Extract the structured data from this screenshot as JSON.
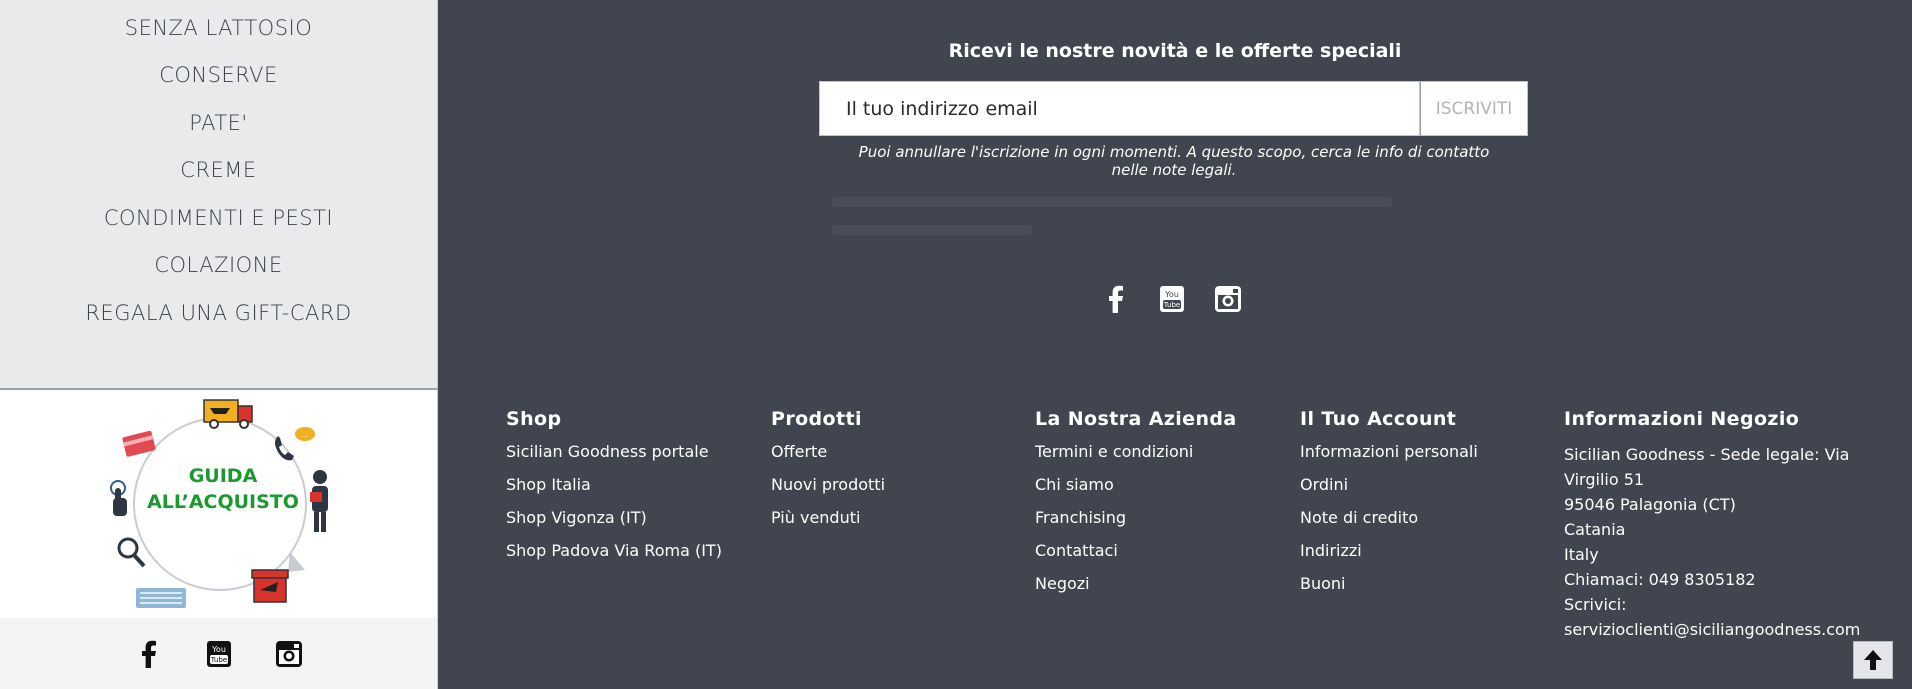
{
  "sidebar": {
    "categories": [
      {
        "label": "SENZA LATTOSIO"
      },
      {
        "label": "CONSERVE"
      },
      {
        "label": "PATE'"
      },
      {
        "label": "CREME"
      },
      {
        "label": "CONDIMENTI E PESTI"
      },
      {
        "label": "COLAZIONE"
      },
      {
        "label": "REGALA UNA GIFT-CARD"
      }
    ],
    "guide_banner": {
      "line1": "GUIDA",
      "line2": "ALL’ACQUISTO"
    },
    "social_icons": [
      "facebook-icon",
      "youtube-icon",
      "instagram-icon"
    ]
  },
  "newsletter": {
    "title": "Ricevi le nostre novità e le offerte speciali",
    "email_placeholder": "Il tuo indirizzo email",
    "subscribe_label": "ISCRIVITI",
    "note": "Puoi annullare l'iscrizione in ogni momenti. A questo scopo, cerca le info di contatto nelle note legali."
  },
  "social_icons": [
    "facebook-icon",
    "youtube-icon",
    "instagram-icon"
  ],
  "footer": {
    "shop": {
      "title": "Shop",
      "links": [
        "Sicilian Goodness portale",
        "Shop Italia",
        "Shop Vigonza (IT)",
        "Shop Padova Via Roma (IT)"
      ]
    },
    "prodotti": {
      "title": "Prodotti",
      "links": [
        "Offerte",
        "Nuovi prodotti",
        "Più venduti"
      ]
    },
    "azienda": {
      "title": "La Nostra Azienda",
      "links": [
        "Termini e condizioni",
        "Chi siamo",
        "Franchising",
        "Contattaci",
        "Negozi"
      ]
    },
    "account": {
      "title": "Il Tuo Account",
      "links": [
        "Informazioni personali",
        "Ordini",
        "Note di credito",
        "Indirizzi",
        "Buoni"
      ]
    },
    "store": {
      "title": "Informazioni Negozio",
      "lines": [
        "Sicilian Goodness - Sede legale: Via",
        "Virgilio 51",
        "95046 Palagonia (CT)",
        "Catania",
        "Italy",
        "Chiamaci: 049 8305182",
        "Scrivici:",
        "servizioclienti@siciliangoodness.com"
      ]
    }
  },
  "colors": {
    "footer_bg": "#40454f",
    "sidebar_bg": "#e9eaec",
    "guide_text": "#1a9a2f",
    "accent_red": "#d9342b",
    "accent_yellow": "#f2b01e"
  }
}
